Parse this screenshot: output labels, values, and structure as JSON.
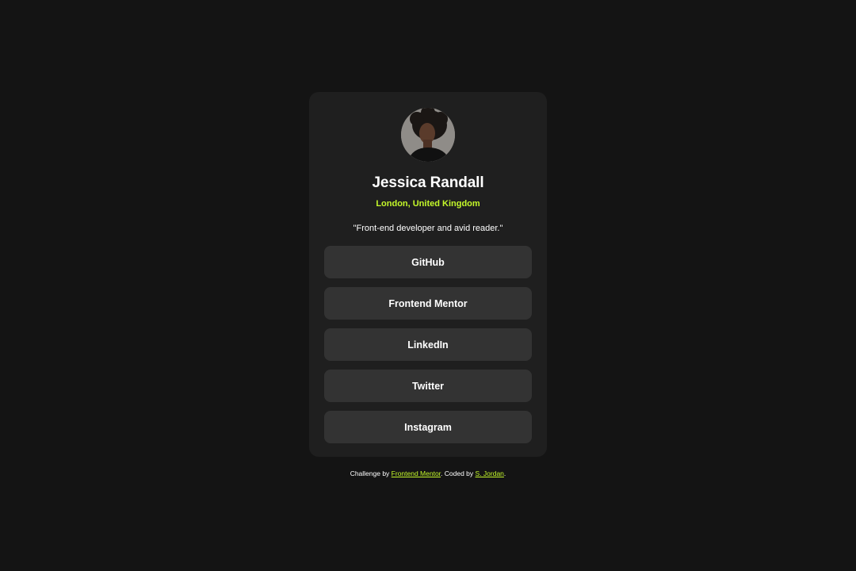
{
  "profile": {
    "name": "Jessica Randall",
    "location": "London, United Kingdom",
    "bio": "\"Front-end developer and avid reader.\"",
    "avatar_icon": "profile-photo"
  },
  "links": [
    {
      "label": "GitHub"
    },
    {
      "label": "Frontend Mentor"
    },
    {
      "label": "LinkedIn"
    },
    {
      "label": "Twitter"
    },
    {
      "label": "Instagram"
    }
  ],
  "attribution": {
    "prefix": "Challenge by ",
    "link1": "Frontend Mentor",
    "middle": ". Coded by ",
    "link2": "S. Jordan",
    "suffix": "."
  },
  "colors": {
    "background": "#141414",
    "card": "#1f1f1f",
    "button": "#333333",
    "accent": "#c4f82a"
  }
}
